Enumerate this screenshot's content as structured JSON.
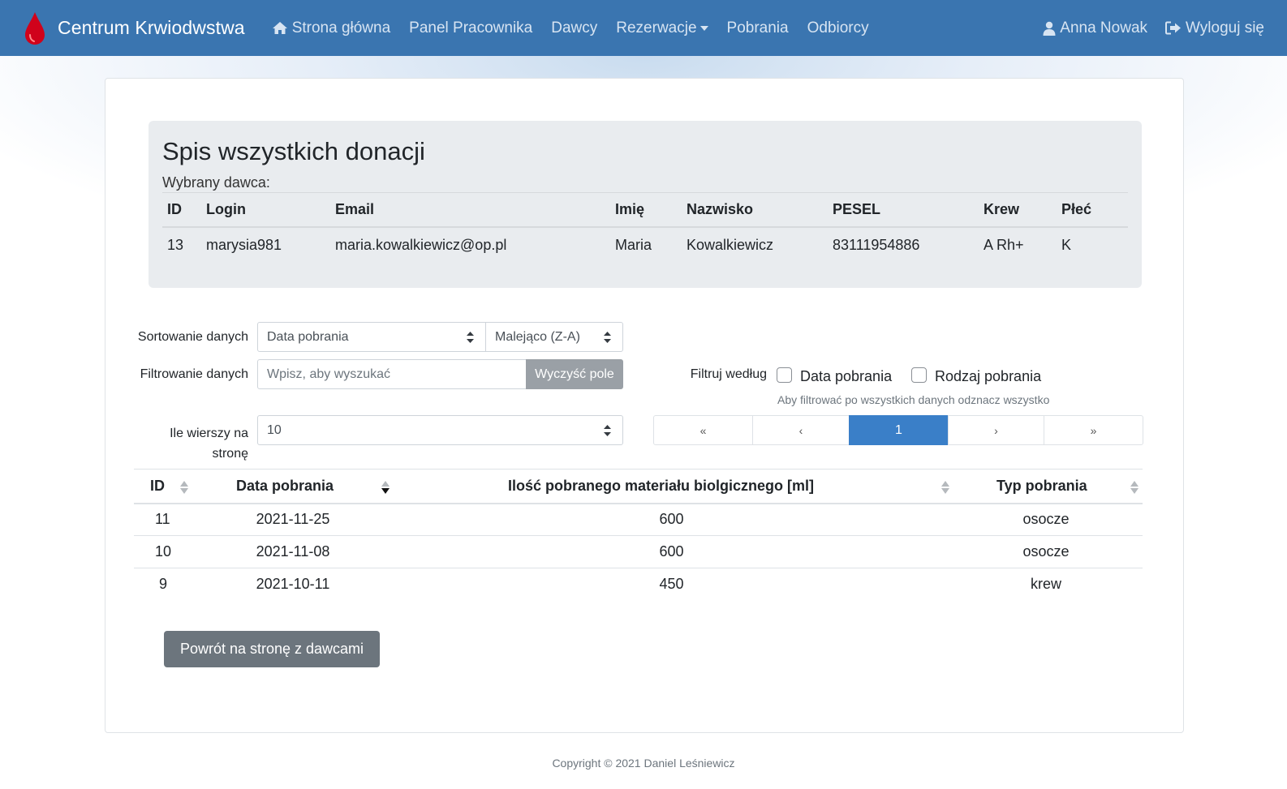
{
  "navbar": {
    "brand": "Centrum Krwiodwstwa",
    "links": [
      "Strona główna",
      "Panel Pracownika",
      "Dawcy",
      "Rezerwacje",
      "Pobrania",
      "Odbiorcy"
    ],
    "user": "Anna Nowak",
    "logout": "Wyloguj się"
  },
  "jumbotron": {
    "title": "Spis wszystkich donacji",
    "subtitle": "Wybrany dawca:",
    "headers": [
      "ID",
      "Login",
      "Email",
      "Imię",
      "Nazwisko",
      "PESEL",
      "Krew",
      "Płeć"
    ],
    "donor": [
      "13",
      "marysia981",
      "maria.kowalkiewicz@op.pl",
      "Maria",
      "Kowalkiewicz",
      "83111954886",
      "A Rh+",
      "K"
    ]
  },
  "controls": {
    "sort_label": "Sortowanie danych",
    "sort_field": "Data pobrania",
    "sort_order": "Malejąco (Z-A)",
    "filter_label": "Filtrowanie danych",
    "filter_placeholder": "Wpisz, aby wyszukać",
    "clear_button": "Wyczyść pole",
    "filter_by_label": "Filtruj według",
    "filter_opt1": "Data pobrania",
    "filter_opt2": "Rodzaj pobrania",
    "filter_hint": "Aby filtrować po wszystkich danych odznacz wszystko",
    "rows_label_1": "Ile wierszy na",
    "rows_label_2": "stronę",
    "rows_value": "10"
  },
  "pagination": {
    "first": "«",
    "prev": "‹",
    "current": "1",
    "next": "›",
    "last": "»"
  },
  "table": {
    "headers": [
      "ID",
      "Data pobrania",
      "Ilość pobranego materiału biolgicznego [ml]",
      "Typ pobrania"
    ],
    "rows": [
      [
        "11",
        "2021-11-25",
        "600",
        "osocze"
      ],
      [
        "10",
        "2021-11-08",
        "600",
        "osocze"
      ],
      [
        "9",
        "2021-10-11",
        "450",
        "krew"
      ]
    ]
  },
  "back_button": "Powrót na stronę z dawcami",
  "footer": "Copyright © 2021 Daniel Leśniewicz",
  "colors": {
    "navbar": "#3a75b0",
    "accent": "#3a7fc8",
    "drop": "#d0021b",
    "back_button": "#6c757d"
  }
}
